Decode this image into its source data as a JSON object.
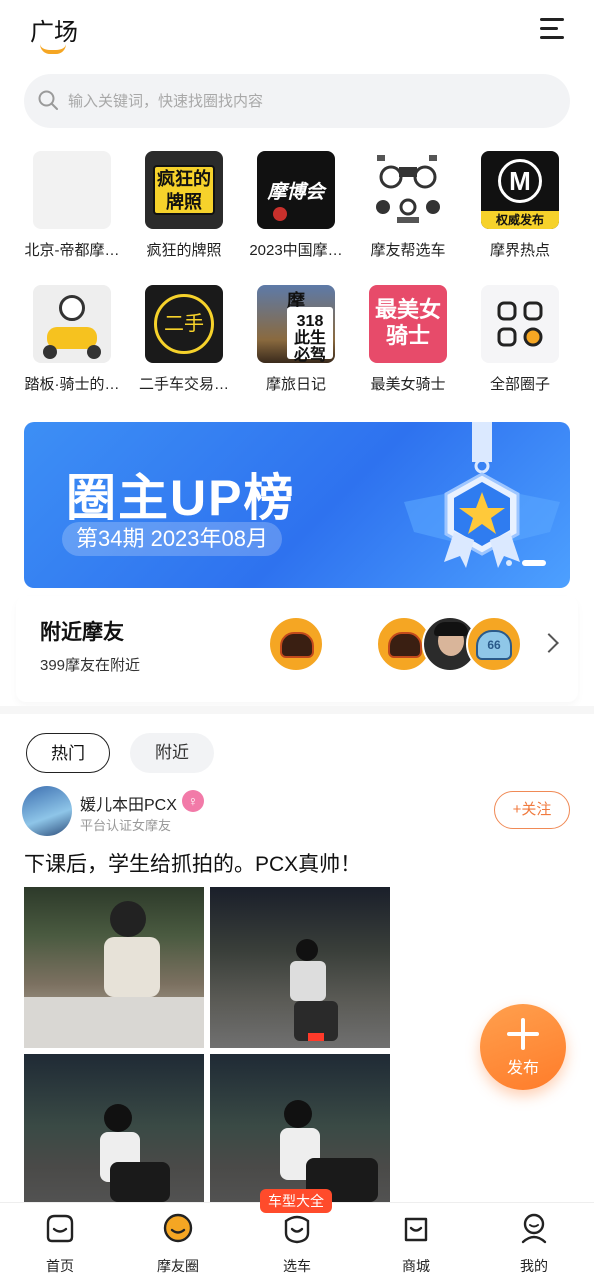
{
  "header": {
    "title": "广场",
    "menu_icon": "menu-icon"
  },
  "search": {
    "placeholder": "输入关键词，快速找圈找内容",
    "icon": "search-icon"
  },
  "circles": [
    {
      "label": "北京-帝都摩…"
    },
    {
      "label": "疯狂的牌照",
      "thumb_text": "疯狂的牌照"
    },
    {
      "label": "2023中国摩…",
      "thumb_text": "摩博会"
    },
    {
      "label": "摩友帮选车"
    },
    {
      "label": "摩界热点",
      "thumb_text": "权威发布"
    },
    {
      "label": "踏板·骑士的…"
    },
    {
      "label": "二手车交易…",
      "thumb_text": "二手"
    },
    {
      "label": "摩旅日记",
      "thumb_text": "摩旅"
    },
    {
      "label": "最美女骑士",
      "thumb_text": "最美女骑士"
    },
    {
      "label": "全部圈子"
    }
  ],
  "banner": {
    "title": "圈主UP榜",
    "subtitle": "第34期  2023年08月",
    "slide_index": 2,
    "slide_count": 2
  },
  "nearby": {
    "title": "附近摩友",
    "subtitle": "399摩友在附近"
  },
  "feed_tabs": [
    {
      "label": "热门",
      "active": true
    },
    {
      "label": "附近",
      "active": false
    }
  ],
  "post": {
    "author": "媛儿本田PCX",
    "gender_badge": "♀",
    "tag": "平台认证女摩友",
    "follow_label": "+关注",
    "text": "下课后，学生给抓拍的。PCX真帅！"
  },
  "fab": {
    "label": "发布"
  },
  "bottom_nav": {
    "badge": "车型大全",
    "items": [
      {
        "label": "首页",
        "icon": "home-icon"
      },
      {
        "label": "摩友圈",
        "icon": "moyou-circle-icon",
        "active": true
      },
      {
        "label": "选车",
        "icon": "select-car-icon"
      },
      {
        "label": "商城",
        "icon": "shop-bag-icon"
      },
      {
        "label": "我的",
        "icon": "profile-icon"
      }
    ]
  },
  "colors": {
    "accent": "#f5a623",
    "follow": "#f07a3e",
    "banner": "#2e72ef",
    "badge": "#ff4b2b"
  }
}
